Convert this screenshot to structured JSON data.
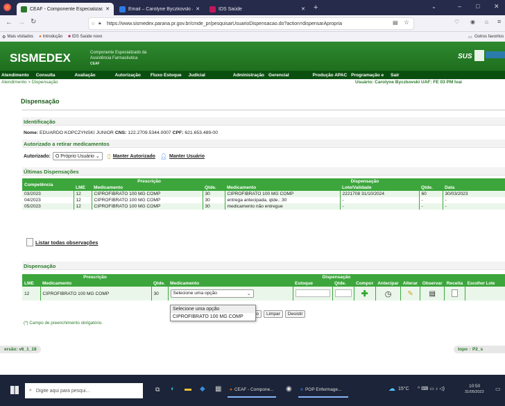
{
  "browser": {
    "tabs": [
      {
        "label": "CEAF - Componente Especializado"
      },
      {
        "label": "Email – Carolyne Byczkovski –"
      },
      {
        "label": "IDS Saúde"
      }
    ],
    "url": "https://www.sismedex.parana.pr.gov.br/cmde_pr/pesquisarUsuarioDispensacao.do?action=dispensarApropria",
    "bookmarks": [
      "Mais visitados",
      "Introdução",
      "IDS Saúde novo"
    ],
    "other_favorites": "Outros favoritos"
  },
  "header": {
    "logo": "SISMEDEX",
    "subtitle_line1": "Componente Especializado da",
    "subtitle_line2": "Assistência Farmacêutica",
    "subtitle_line3": "CEAF",
    "sus": "SUS"
  },
  "menu": [
    "Atendimento",
    "Consulta",
    "Avaliação",
    "Autorização",
    "Fluxo Estoque",
    "Judicial",
    "Administração",
    "Gerencial",
    "Produção APAC",
    "Programação e",
    "Sair"
  ],
  "breadcrumb": "Atendimento > Dispensação",
  "user_info": "Usuário: Carolyne Byczkovski UAF: FE 03 PM Ivai",
  "page_title": "Dispensação",
  "identificacao": {
    "title": "Identificação",
    "nome_label": "Nome:",
    "nome": "EDUARDO KOPCZYNSKI JUNIOR",
    "cns_label": "CNS:",
    "cns": "122.2709.5344.0007",
    "cpf_label": "CPF:",
    "cpf": "621.653.489-00"
  },
  "autorizados": {
    "title": "Autorizado a retirar medicamentos",
    "label": "Autorizado:",
    "selected": "O Próprio Usuário",
    "manter_autorizado": "Manter Autorizado",
    "manter_usuario": "Manter Usuário"
  },
  "ultimas": {
    "title": "Últimas Dispensações",
    "group_prescricao": "Prescrição",
    "group_dispensacao": "Dispensação",
    "headers": [
      "Competência",
      "LME",
      "Medicamento",
      "Qtde.",
      "Medicamento",
      "Lote/Validade",
      "Qtde.",
      "Data"
    ],
    "rows": [
      [
        "03/2023",
        "12",
        "CIPROFIBRATO 100 MG COMP",
        "30",
        "CIPROFIBRATO 100 MG COMP",
        "2221708 31/10/2024",
        "60",
        "30/03/2023"
      ],
      [
        "04/2023",
        "12",
        "CIPROFIBRATO 100 MG COMP",
        "30",
        "entrega antecipada, qtde.: 30",
        "-",
        "-",
        "-"
      ],
      [
        "05/2023",
        "12",
        "CIPROFIBRATO 100 MG COMP",
        "30",
        "medicamento não entregue",
        "-",
        "-",
        "-"
      ]
    ]
  },
  "listar_obs": "Listar todas observações",
  "dispensacao": {
    "title": "Dispensação",
    "group_prescricao": "Prescrição",
    "group_dispensacao": "Dispensação",
    "headers": [
      "LME",
      "Medicamento",
      "Qtde.",
      "Medicamento",
      "Estoque",
      "Qtde.",
      "Compor",
      "Antecipar",
      "Alterar",
      "Observar",
      "Receita",
      "Escolher Lote"
    ],
    "row": {
      "lme": "12",
      "medicamento": "CIPROFIBRATO 100 MG COMP",
      "qtde": "30",
      "select": "Selecione uma opção"
    },
    "dropdown_options": [
      "Selecione uma opção",
      "CIPROFIBRATO 100 MG COMP"
    ],
    "buttons": {
      "recibo": "cibo",
      "limpar": "Limpar",
      "desistir": "Desistir"
    },
    "obrigatorio": "(*) Campo de preenchimento obrigatório."
  },
  "footer": {
    "versao": "ersão: v6_1_18",
    "topo": "topo",
    "p2": "P2_s"
  },
  "taskbar": {
    "search": "Digite aqui para pesqui...",
    "item1": "CEAF - Compone...",
    "item2": "POP Enfermage...",
    "temp": "15°C",
    "time": "10:50",
    "date": "31/05/2023"
  },
  "colors": {
    "header_green": "#2f8a2f",
    "menu_dark": "#0b4f10",
    "table_green": "#3ca63c"
  }
}
